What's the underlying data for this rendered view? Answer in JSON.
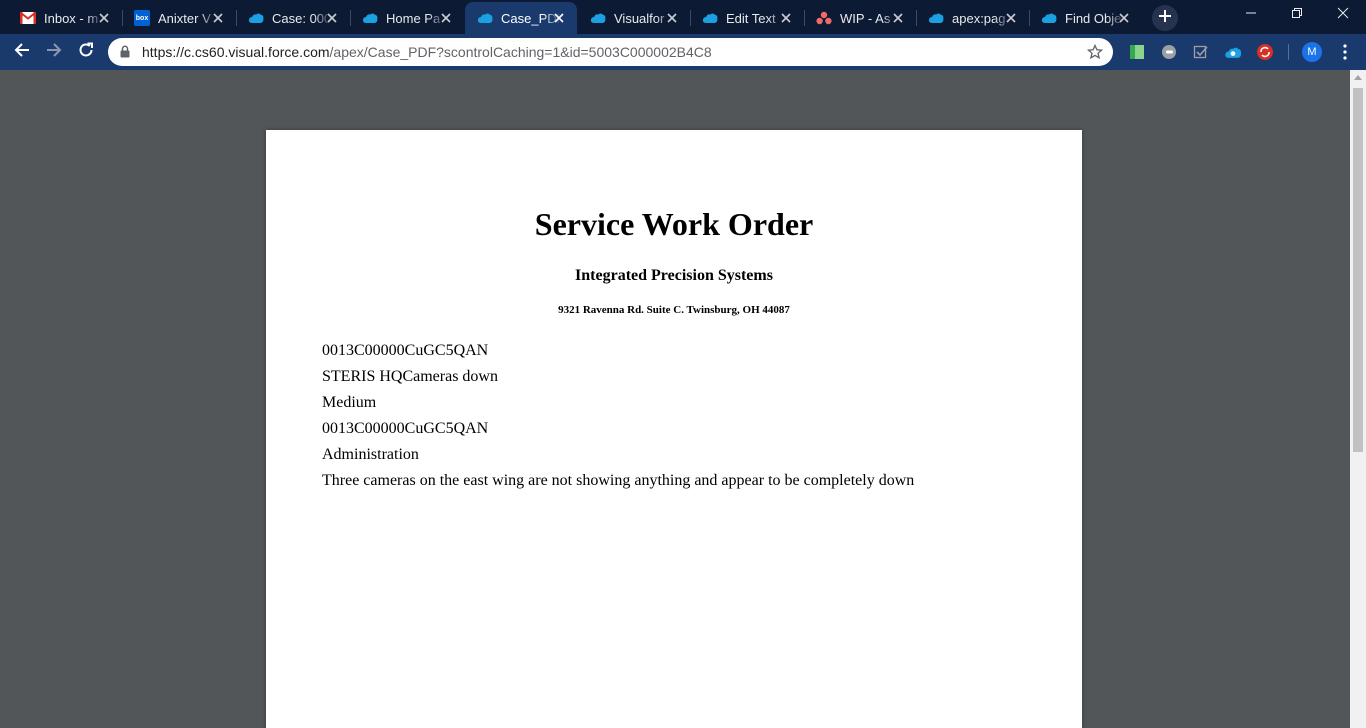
{
  "browser": {
    "tabs": [
      {
        "label": "Inbox - m",
        "icon": "gmail-icon"
      },
      {
        "label": "Anixter V",
        "icon": "box-icon",
        "icon_text": "box"
      },
      {
        "label": "Case: 000",
        "icon": "salesforce-cloud-icon"
      },
      {
        "label": "Home Pa",
        "icon": "salesforce-cloud-icon"
      },
      {
        "label": "Case_PDF",
        "icon": "salesforce-cloud-icon",
        "active": true
      },
      {
        "label": "Visualfor",
        "icon": "salesforce-cloud-icon"
      },
      {
        "label": "Edit Text",
        "icon": "salesforce-cloud-icon"
      },
      {
        "label": "WIP - As",
        "icon": "asana-icon"
      },
      {
        "label": "apex:pag",
        "icon": "salesforce-cloud-icon"
      },
      {
        "label": "Find Obje",
        "icon": "salesforce-cloud-icon"
      }
    ],
    "url_host": "https://c.cs60.visual.force.com",
    "url_path": "/apex/Case_PDF?scontrolCaching=1&id=5003C000002B4C8",
    "profile_initial": "M",
    "colors": {
      "tabstrip": "#0d1a33",
      "toolbar": "#1a3a6e",
      "viewer_bg": "#525659",
      "page_bg": "#ffffff"
    }
  },
  "document": {
    "title": "Service Work Order",
    "company": "Integrated Precision Systems",
    "address": "9321 Ravenna Rd. Suite C. Twinsburg, OH 44087",
    "fields": [
      "0013C00000CuGC5QAN",
      "STERIS HQCameras down",
      "Medium",
      "0013C00000CuGC5QAN",
      "Administration",
      "Three cameras on the east wing are not showing anything and appear to be completely down"
    ]
  }
}
